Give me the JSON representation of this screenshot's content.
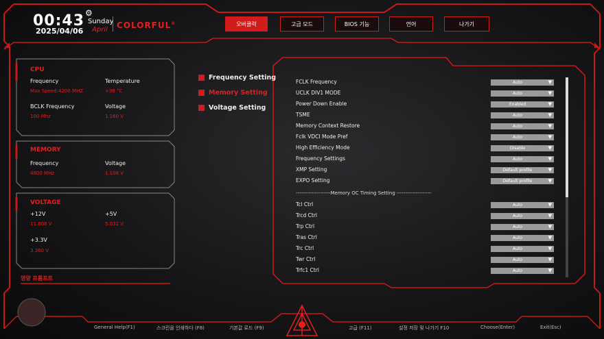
{
  "header": {
    "time": "00:43",
    "date": "2025/04/06",
    "day": "Sunday",
    "month": "April",
    "brand": "COLORFUL",
    "brand_mark": "®"
  },
  "tabs": [
    {
      "label": "오버클럭",
      "active": true
    },
    {
      "label": "고급 모드",
      "active": false
    },
    {
      "label": "BIOS 기능",
      "active": false
    },
    {
      "label": "언어",
      "active": false
    },
    {
      "label": "나가기",
      "active": false
    }
  ],
  "cpu": {
    "title": "CPU",
    "freq_label": "Frequency",
    "freq_value": "Max Speed:4200 MHZ",
    "temp_label": "Temperature",
    "temp_value": "+38 °C",
    "bclk_label": "BCLK Frequency",
    "bclk_value": "100 Mhz",
    "volt_label": "Voltage",
    "volt_value": "1.160 V"
  },
  "memory": {
    "title": "MEMORY",
    "freq_label": "Frequency",
    "freq_value": "4800 MHz",
    "volt_label": "Voltage",
    "volt_value": "1.108 V"
  },
  "voltage": {
    "title": "VOLTAGE",
    "v12_label": "+12V",
    "v12_value": "11.808 V",
    "v5_label": "+5V",
    "v5_value": "5.032 V",
    "v33_label": "+3.3V",
    "v33_value": "3.360 V"
  },
  "side_prompt": "영양 프롬프트",
  "menu": [
    {
      "label": "Frequency Setting",
      "active": false
    },
    {
      "label": "Memory Setting",
      "active": true
    },
    {
      "label": "Voltage Setting",
      "active": false
    }
  ],
  "settings_top": [
    {
      "label": "FCLK Frequency",
      "value": "Auto"
    },
    {
      "label": "UCLK DIV1 MODE",
      "value": "Auto"
    },
    {
      "label": "Power Down Enable",
      "value": "Enabled"
    },
    {
      "label": "TSME",
      "value": "Auto"
    },
    {
      "label": "Memory Context Restore",
      "value": "Auto"
    },
    {
      "label": "Fclk VDCI Mode Pref",
      "value": "Auto"
    },
    {
      "label": "High Efficiency Mode",
      "value": "Disable"
    },
    {
      "label": "Frequency Settings",
      "value": "Auto"
    },
    {
      "label": "XMP Setting",
      "value": "Default profile"
    },
    {
      "label": "EXPO Setting",
      "value": "Default profile"
    }
  ],
  "separator": "--------------------Memory OC Timing Setting --------------------",
  "settings_timing": [
    {
      "label": "Tcl Ctrl",
      "value": "Auto"
    },
    {
      "label": "Trcd Ctrl",
      "value": "Auto"
    },
    {
      "label": "Trp Ctrl",
      "value": "Auto"
    },
    {
      "label": "Tras Ctrl",
      "value": "Auto"
    },
    {
      "label": "Trc Ctrl",
      "value": "Auto"
    },
    {
      "label": "Twr Ctrl",
      "value": "Auto"
    },
    {
      "label": "Trfc1 Ctrl",
      "value": "Auto"
    }
  ],
  "footer": [
    "General Help(F1)",
    "스크린을 인쇄하다 (F8)",
    "기본값 로드 (F9)",
    "고급 (F11)",
    "설정 저장 및 나가기 F10",
    "Choose(Enter)",
    "Exit(Esc)"
  ],
  "colors": {
    "accent": "#d21c1c",
    "background": "#1c1c1e"
  }
}
